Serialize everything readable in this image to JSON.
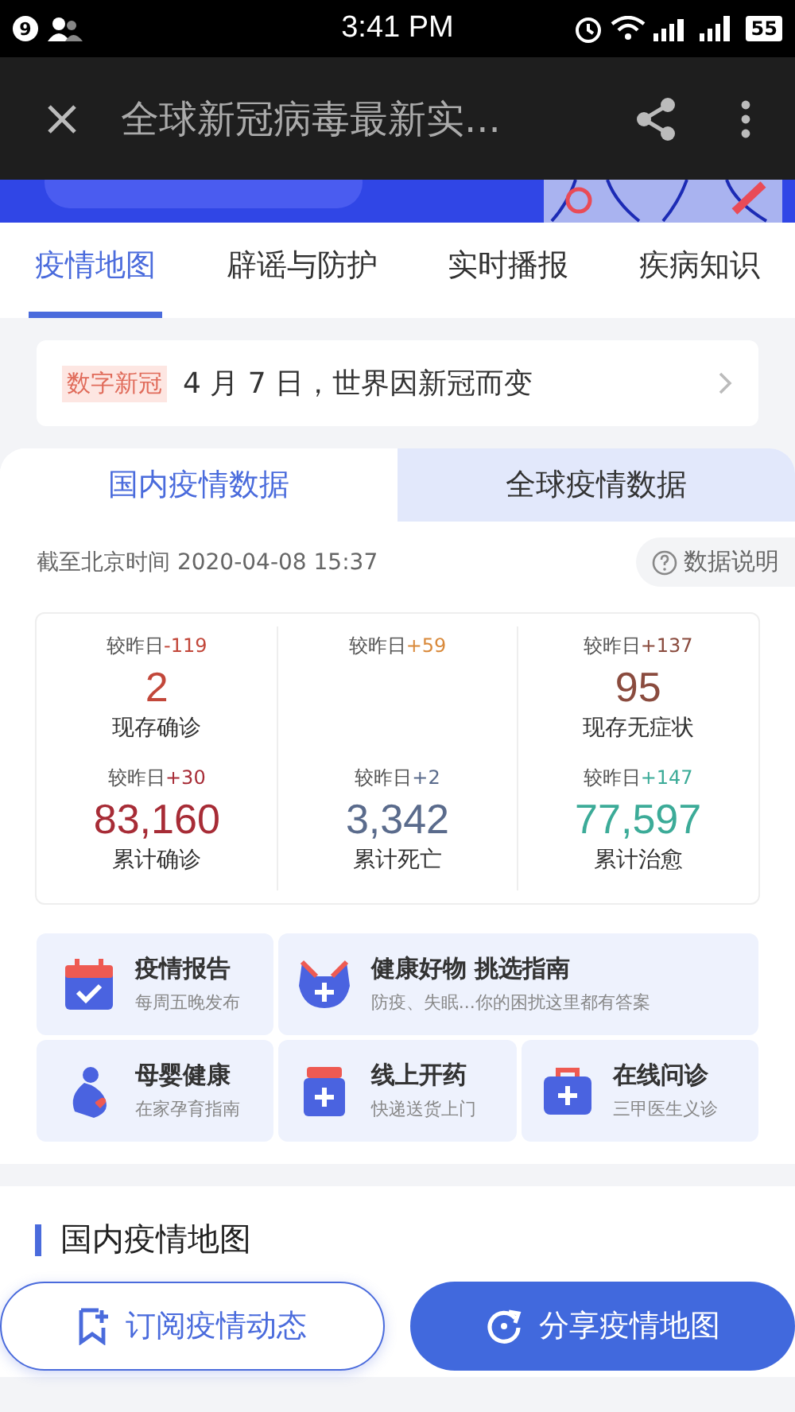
{
  "status_bar": {
    "notification_count": "9",
    "time": "3:41 PM",
    "battery": "55"
  },
  "app_bar": {
    "title": "全球新冠病毒最新实..."
  },
  "tabs": [
    {
      "label": "疫情地图",
      "selected": true
    },
    {
      "label": "辟谣与防护",
      "selected": false
    },
    {
      "label": "实时播报",
      "selected": false
    },
    {
      "label": "疾病知识",
      "selected": false
    }
  ],
  "notice": {
    "tag": "数字新冠",
    "text": "4 月 7 日，世界因新冠而变"
  },
  "data_tabs": [
    {
      "label": "国内疫情数据",
      "selected": true
    },
    {
      "label": "全球疫情数据",
      "selected": false
    }
  ],
  "updated": "截至北京时间 2020-04-08 15:37",
  "data_note": "数据说明",
  "stats": [
    {
      "change_label": "较昨日",
      "change": "-119",
      "value": "2",
      "label": "现存确诊",
      "color": "#c2473a"
    },
    {
      "change_label": "较昨日",
      "change": "+59",
      "color": "#d9893a"
    },
    {
      "change_label": "较昨日",
      "change": "+137",
      "value": "95",
      "label": "现存无症状",
      "color": "#8a4b3e"
    },
    {
      "change_label": "较昨日",
      "change": "+30",
      "value": "83,160",
      "label": "累计确诊",
      "color": "#a72c36"
    },
    {
      "change_label": "较昨日",
      "change": "+2",
      "value": "3,342",
      "label": "累计死亡",
      "color": "#5a6b8c"
    },
    {
      "change_label": "较昨日",
      "change": "+147",
      "value": "77,597",
      "label": "累计治愈",
      "color": "#3cab98"
    }
  ],
  "services": [
    {
      "kind": "calendar",
      "title": "疫情报告",
      "subtitle": "每周五晚发布"
    },
    {
      "kind": "mask",
      "title": "健康好物 挑选指南",
      "subtitle": "防疫、失眠...你的困扰这里都有答案"
    },
    {
      "kind": "mother",
      "title": "母婴健康",
      "subtitle": "在家孕育指南"
    },
    {
      "kind": "medicine",
      "title": "线上开药",
      "subtitle": "快递送货上门"
    },
    {
      "kind": "kit",
      "title": "在线问诊",
      "subtitle": "三甲医生义诊"
    }
  ],
  "section_title": "国内疫情地图",
  "actions": [
    {
      "kind": "outline",
      "label": "订阅疫情动态"
    },
    {
      "kind": "filled",
      "label": "分享疫情地图"
    }
  ]
}
